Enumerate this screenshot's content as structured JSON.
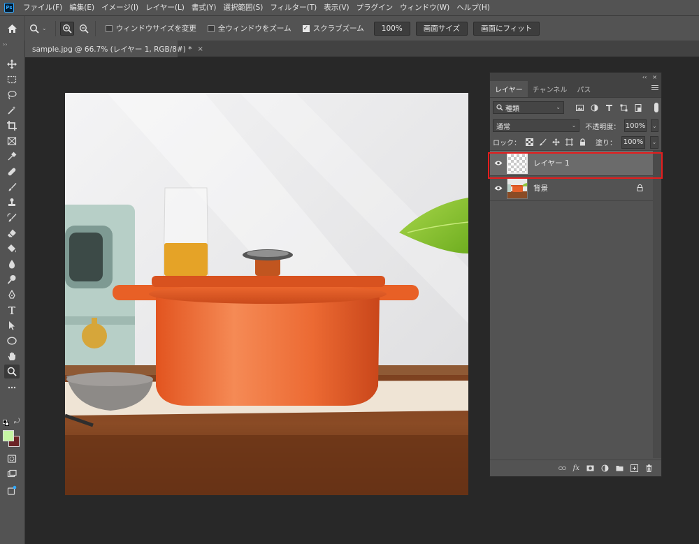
{
  "menubar": {
    "app_icon": "Ps",
    "items": [
      "ファイル(F)",
      "編集(E)",
      "イメージ(I)",
      "レイヤー(L)",
      "書式(Y)",
      "選択範囲(S)",
      "フィルター(T)",
      "表示(V)",
      "プラグイン",
      "ウィンドウ(W)",
      "ヘルプ(H)"
    ]
  },
  "options": {
    "resize_windows": "ウィンドウサイズを変更",
    "zoom_all": "全ウィンドウをズーム",
    "scrubby_zoom": "スクラブズーム",
    "zoom_value": "100%",
    "fit_screen": "画面サイズ",
    "fill_screen": "画面にフィット"
  },
  "document": {
    "tab_title": "sample.jpg @ 66.7% (レイヤー 1, RGB/8#) *",
    "close": "×"
  },
  "layers_panel": {
    "collapse": "‹‹",
    "close": "×",
    "tabs": [
      "レイヤー",
      "チャンネル",
      "パス"
    ],
    "filter_kind": "種類",
    "blend_mode": "通常",
    "opacity_label": "不透明度：",
    "opacity_value": "100%",
    "lock_label": "ロック：",
    "fill_label": "塗り：",
    "fill_value": "100%",
    "layers": [
      {
        "name": "レイヤー 1",
        "selected": true,
        "thumbnail": "transparent"
      },
      {
        "name": "背景",
        "selected": false,
        "locked": true,
        "thumbnail": "photo"
      }
    ]
  },
  "colors": {
    "foreground": "#c5f5a3",
    "background": "#6b2426",
    "highlight": "#e51d1d"
  },
  "toolbar_icons": [
    "move-icon",
    "marquee-icon",
    "lasso-icon",
    "magic-wand-icon",
    "crop-icon",
    "frame-icon",
    "eyedropper-icon",
    "healing-brush-icon",
    "brush-icon",
    "stamp-icon",
    "history-brush-icon",
    "eraser-icon",
    "paint-bucket-icon",
    "blur-icon",
    "dodge-icon",
    "pen-icon",
    "type-icon",
    "path-select-icon",
    "ellipse-icon",
    "hand-icon",
    "zoom-icon",
    "more-tools-icon"
  ]
}
